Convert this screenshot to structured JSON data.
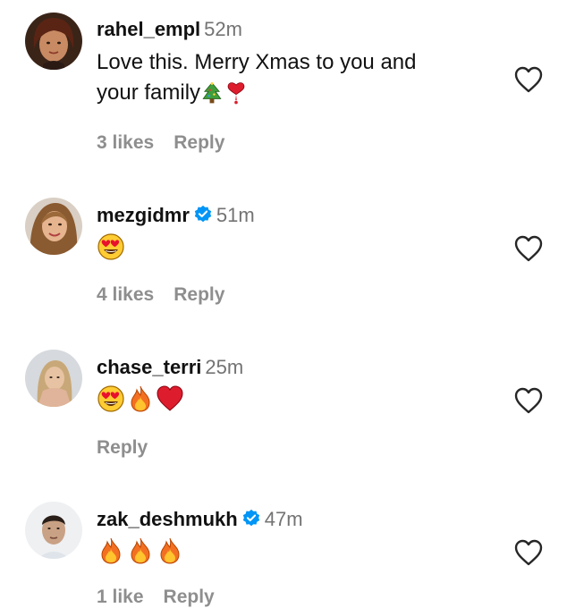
{
  "comments": [
    {
      "username": "rahel_empl",
      "time": "52m",
      "verified": false,
      "text_line1": "Love this. Merry Xmas to you and",
      "text_line2": "your family",
      "emojis_after": [
        "christmas-tree",
        "heavy-heart-exclamation"
      ],
      "likes": "3 likes",
      "reply": "Reply"
    },
    {
      "username": "mezgidmr",
      "time": "51m",
      "verified": true,
      "emojis": [
        "heart-eyes-face"
      ],
      "likes": "4 likes",
      "reply": "Reply"
    },
    {
      "username": "chase_terri",
      "time": "25m",
      "verified": false,
      "emojis": [
        "heart-eyes-face",
        "fire",
        "red-heart"
      ],
      "likes": "",
      "reply": "Reply"
    },
    {
      "username": "zak_deshmukh",
      "time": "47m",
      "verified": true,
      "emojis": [
        "fire",
        "fire",
        "fire"
      ],
      "likes": "1 like",
      "reply": "Reply"
    }
  ],
  "colors": {
    "secondary_text": "#737373",
    "meta_text": "#8e8e8e",
    "verified_blue": "#0095f6"
  }
}
